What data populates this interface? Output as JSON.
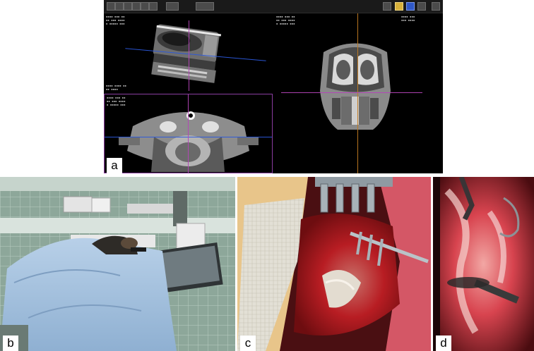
{
  "panels": {
    "a": {
      "label": "a"
    },
    "b": {
      "label": "b"
    },
    "c": {
      "label": "c"
    },
    "d": {
      "label": "d"
    }
  },
  "colors": {
    "crosshair_blue": "#2b58dc",
    "crosshair_orange": "#c17a21",
    "crosshair_purple": "#b445b8",
    "surgical_drape": "#a9c4e0",
    "tissue_red": "#b8101e"
  }
}
